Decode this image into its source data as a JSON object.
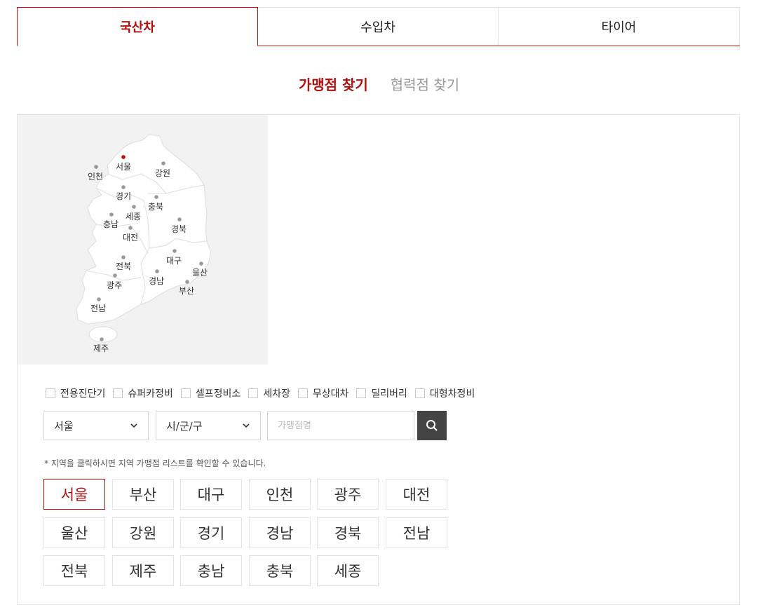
{
  "tabs": [
    {
      "label": "국산차",
      "active": true
    },
    {
      "label": "수입차",
      "active": false
    },
    {
      "label": "타이어",
      "active": false
    }
  ],
  "subtabs": [
    {
      "label": "가맹점 찾기",
      "active": true
    },
    {
      "label": "협력점 찾기",
      "active": false
    }
  ],
  "map": {
    "labels": [
      "서울",
      "인천",
      "강원",
      "경기",
      "충북",
      "충남",
      "세종",
      "경북",
      "대전",
      "전북",
      "대구",
      "울산",
      "광주",
      "경남",
      "부산",
      "전남",
      "제주"
    ],
    "selected": "서울"
  },
  "filters": [
    "전용진단기",
    "슈퍼카정비",
    "셀프정비소",
    "세차장",
    "무상대차",
    "딜리버리",
    "대형차정비"
  ],
  "search": {
    "region_select": "서울",
    "district_select": "시/군/구",
    "placeholder": "가맹점명"
  },
  "notice": "* 지역을 클릭하시면 지역 가맹점 리스트를 확인할 수 있습니다.",
  "regions": [
    "서울",
    "부산",
    "대구",
    "인천",
    "광주",
    "대전",
    "울산",
    "강원",
    "경기",
    "경남",
    "경북",
    "전남",
    "전북",
    "제주",
    "충남",
    "충북",
    "세종"
  ],
  "selected_region": "서울",
  "colors": {
    "accent": "#b20f0f",
    "search_button": "#444444",
    "map_bg": "#f2f2f2"
  },
  "icons": {
    "search": "search-icon",
    "dropdown": "chevron-down-icon"
  }
}
